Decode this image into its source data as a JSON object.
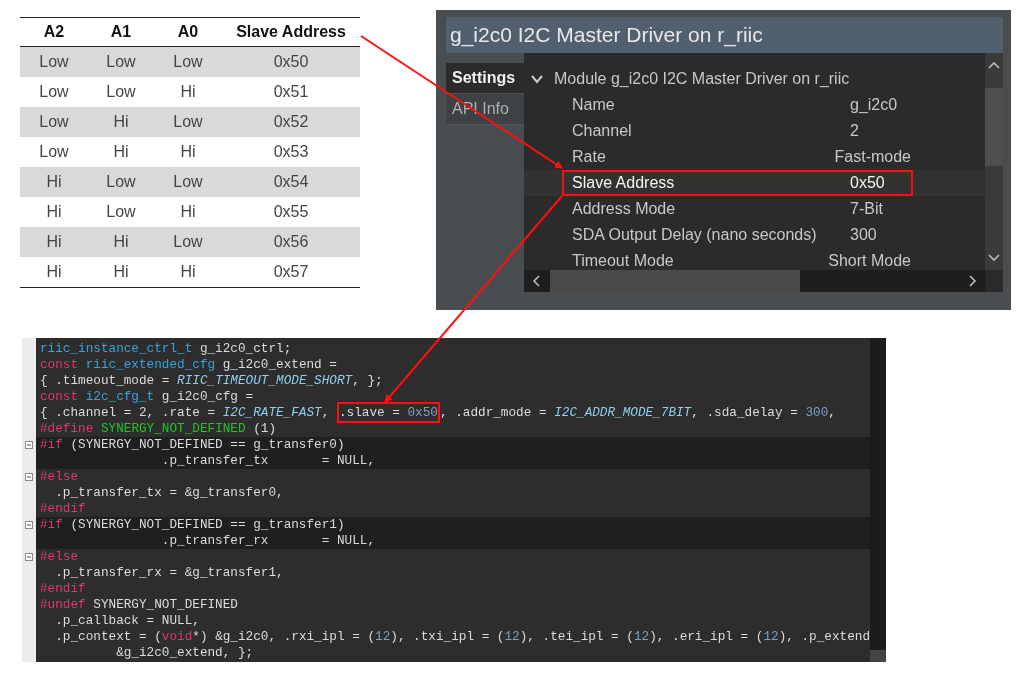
{
  "address_table": {
    "columns": [
      "A2",
      "A1",
      "A0",
      "Slave Address"
    ],
    "rows": [
      [
        "Low",
        "Low",
        "Low",
        "0x50"
      ],
      [
        "Low",
        "Low",
        "Hi",
        "0x51"
      ],
      [
        "Low",
        "Hi",
        "Low",
        "0x52"
      ],
      [
        "Low",
        "Hi",
        "Hi",
        "0x53"
      ],
      [
        "Hi",
        "Low",
        "Low",
        "0x54"
      ],
      [
        "Hi",
        "Low",
        "Hi",
        "0x55"
      ],
      [
        "Hi",
        "Hi",
        "Low",
        "0x56"
      ],
      [
        "Hi",
        "Hi",
        "Hi",
        "0x57"
      ]
    ]
  },
  "properties_panel": {
    "title": "g_i2c0 I2C Master Driver on r_riic",
    "tabs": [
      {
        "label": "Settings",
        "selected": true
      },
      {
        "label": "API Info",
        "selected": false
      }
    ],
    "section": {
      "label": "Module g_i2c0 I2C Master Driver on r_riic",
      "expanded": true
    },
    "properties": [
      {
        "name": "Name",
        "value": "g_i2c0",
        "selected": false
      },
      {
        "name": "Channel",
        "value": "2",
        "selected": false
      },
      {
        "name": "Rate",
        "value": "Fast-mode",
        "selected": false
      },
      {
        "name": "Slave Address",
        "value": "0x50",
        "selected": true
      },
      {
        "name": "Address Mode",
        "value": "7-Bit",
        "selected": false
      },
      {
        "name": "SDA Output Delay (nano seconds)",
        "value": "300",
        "selected": false
      },
      {
        "name": "Timeout Mode",
        "value": "Short Mode",
        "selected": false
      }
    ]
  },
  "code_editor": {
    "lines": [
      {
        "highlighted": false,
        "fold": false,
        "segments": [
          {
            "text": "riic_instance_ctrl_t",
            "kind": "type"
          },
          {
            "text": " g_i2c0_ctrl;",
            "kind": "plain"
          }
        ]
      },
      {
        "highlighted": false,
        "fold": false,
        "segments": [
          {
            "text": "const ",
            "kind": "keyword"
          },
          {
            "text": "riic_extended_cfg",
            "kind": "type"
          },
          {
            "text": " g_i2c0_extend =",
            "kind": "plain"
          }
        ]
      },
      {
        "highlighted": false,
        "fold": false,
        "segments": [
          {
            "text": "{ .timeout_mode = ",
            "kind": "plain"
          },
          {
            "text": "RIIC_TIMEOUT_MODE_SHORT",
            "kind": "enum"
          },
          {
            "text": ", };",
            "kind": "plain"
          }
        ]
      },
      {
        "highlighted": false,
        "fold": false,
        "segments": [
          {
            "text": "const ",
            "kind": "keyword"
          },
          {
            "text": "i2c_cfg_t",
            "kind": "type"
          },
          {
            "text": " g_i2c0_cfg =",
            "kind": "plain"
          }
        ]
      },
      {
        "highlighted": false,
        "fold": false,
        "segments": [
          {
            "text": "{ .channel = 2, .rate = ",
            "kind": "plain"
          },
          {
            "text": "I2C_RATE_FAST",
            "kind": "enum"
          },
          {
            "text": ", ",
            "kind": "plain"
          },
          {
            "kind": "boxed",
            "parts": [
              {
                "text": ".slave = ",
                "kind": "plain"
              },
              {
                "text": "0x50",
                "kind": "number"
              }
            ]
          },
          {
            "text": ", .addr_mode = ",
            "kind": "plain"
          },
          {
            "text": "I2C_ADDR_MODE_7BIT",
            "kind": "enum"
          },
          {
            "text": ", .sda_delay = ",
            "kind": "plain"
          },
          {
            "text": "300",
            "kind": "number"
          },
          {
            "text": ",",
            "kind": "plain"
          }
        ]
      },
      {
        "highlighted": false,
        "fold": false,
        "segments": [
          {
            "text": "#define ",
            "kind": "keyword"
          },
          {
            "text": "SYNERGY_NOT_DEFINED",
            "kind": "macro"
          },
          {
            "text": " (1)",
            "kind": "plain"
          }
        ]
      },
      {
        "highlighted": true,
        "fold": true,
        "segments": [
          {
            "text": "#if",
            "kind": "keyword"
          },
          {
            "text": " (SYNERGY_NOT_DEFINED == g_transfer0)",
            "kind": "plain"
          }
        ]
      },
      {
        "highlighted": true,
        "fold": false,
        "segments": [
          {
            "text": "                .p_transfer_tx       = NULL,",
            "kind": "plain"
          }
        ]
      },
      {
        "highlighted": false,
        "fold": true,
        "segments": [
          {
            "text": "#else",
            "kind": "keyword"
          }
        ]
      },
      {
        "highlighted": false,
        "fold": false,
        "segments": [
          {
            "text": "  .p_transfer_tx = &g_transfer0,",
            "kind": "plain"
          }
        ]
      },
      {
        "highlighted": false,
        "fold": false,
        "segments": [
          {
            "text": "#endif",
            "kind": "keyword"
          }
        ]
      },
      {
        "highlighted": true,
        "fold": true,
        "segments": [
          {
            "text": "#if",
            "kind": "keyword"
          },
          {
            "text": " (SYNERGY_NOT_DEFINED == g_transfer1)",
            "kind": "plain"
          }
        ]
      },
      {
        "highlighted": true,
        "fold": false,
        "segments": [
          {
            "text": "                .p_transfer_rx       = NULL,",
            "kind": "plain"
          }
        ]
      },
      {
        "highlighted": false,
        "fold": true,
        "segments": [
          {
            "text": "#else",
            "kind": "keyword"
          }
        ]
      },
      {
        "highlighted": false,
        "fold": false,
        "segments": [
          {
            "text": "  .p_transfer_rx = &g_transfer1,",
            "kind": "plain"
          }
        ]
      },
      {
        "highlighted": false,
        "fold": false,
        "segments": [
          {
            "text": "#endif",
            "kind": "keyword"
          }
        ]
      },
      {
        "highlighted": false,
        "fold": false,
        "segments": [
          {
            "text": "#undef",
            "kind": "keyword"
          },
          {
            "text": " SYNERGY_NOT_DEFINED",
            "kind": "plain"
          }
        ]
      },
      {
        "highlighted": false,
        "fold": false,
        "segments": [
          {
            "text": "  .p_callback = NULL,",
            "kind": "plain"
          }
        ]
      },
      {
        "highlighted": false,
        "fold": false,
        "segments": [
          {
            "text": "  .p_context = (",
            "kind": "plain"
          },
          {
            "text": "void",
            "kind": "keyword"
          },
          {
            "text": "*) &g_i2c0, .rxi_ipl = (",
            "kind": "plain"
          },
          {
            "text": "12",
            "kind": "number"
          },
          {
            "text": "), .txi_ipl = (",
            "kind": "plain"
          },
          {
            "text": "12",
            "kind": "number"
          },
          {
            "text": "), .tei_ipl = (",
            "kind": "plain"
          },
          {
            "text": "12",
            "kind": "number"
          },
          {
            "text": "), .eri_ipl = (",
            "kind": "plain"
          },
          {
            "text": "12",
            "kind": "number"
          },
          {
            "text": "), .p_extend",
            "kind": "plain"
          }
        ]
      },
      {
        "highlighted": false,
        "fold": false,
        "segments": [
          {
            "text": "          &g_i2c0_extend, };",
            "kind": "plain"
          }
        ]
      }
    ]
  }
}
